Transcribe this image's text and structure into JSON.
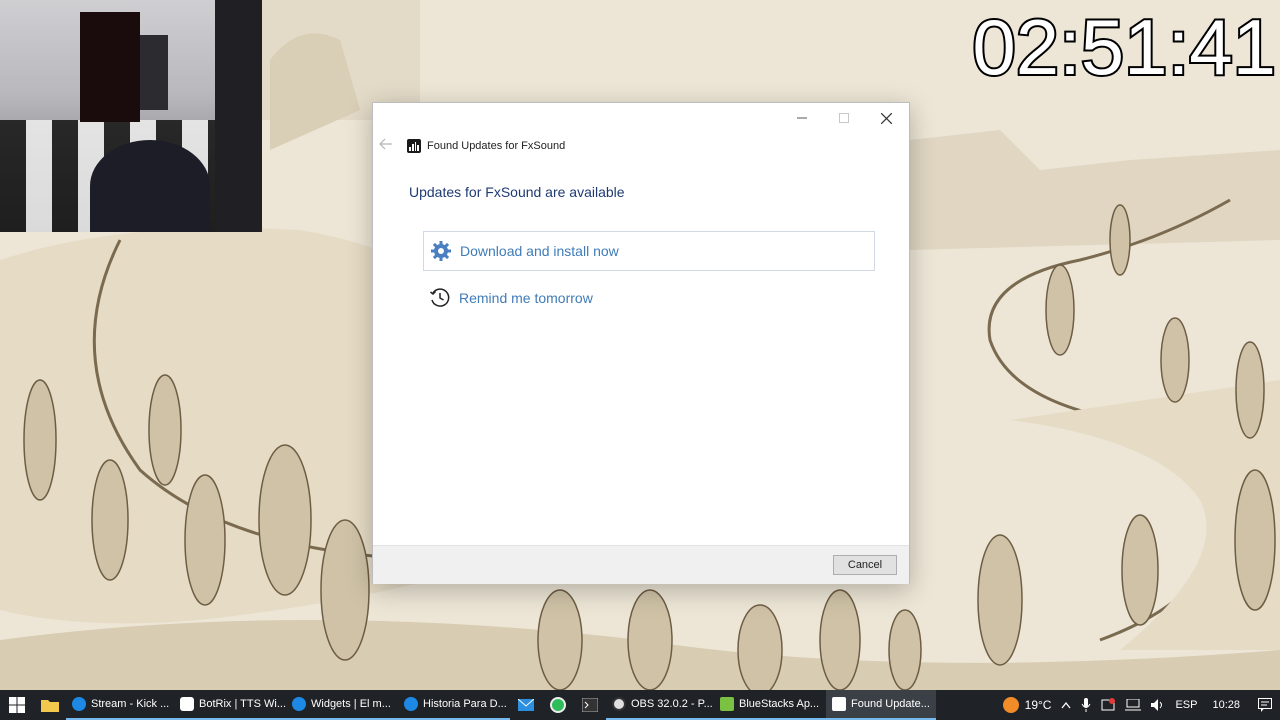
{
  "stream_timer": "02:51:41",
  "dialog": {
    "title": "Found Updates for FxSound",
    "heading": "Updates for FxSound are available",
    "options": [
      {
        "label": "Download and install now",
        "icon": "gear-icon"
      },
      {
        "label": "Remind me tomorrow",
        "icon": "clock-history-icon"
      }
    ],
    "cancel_label": "Cancel"
  },
  "taskbar": {
    "apps": [
      {
        "label": "Stream - Kick ...",
        "icon": "edge-icon",
        "color": "#1e88e5"
      },
      {
        "label": "BotRix | TTS Wi...",
        "icon": "botrix-icon",
        "color": "#ffffff"
      },
      {
        "label": "Widgets | El m...",
        "icon": "edge-icon",
        "color": "#1e88e5"
      },
      {
        "label": "Historia Para D...",
        "icon": "edge-icon",
        "color": "#1e88e5"
      },
      {
        "label": "OBS 32.0.2 - P...",
        "icon": "obs-icon",
        "color": "#e0e0e0"
      },
      {
        "label": "BlueStacks Ap...",
        "icon": "bluestacks-icon",
        "color": "#7cc242"
      },
      {
        "label": "Found Update...",
        "icon": "fxsound-icon",
        "color": "#ffffff"
      }
    ],
    "weather": "19°C",
    "language": "ESP",
    "time": "10:28"
  }
}
